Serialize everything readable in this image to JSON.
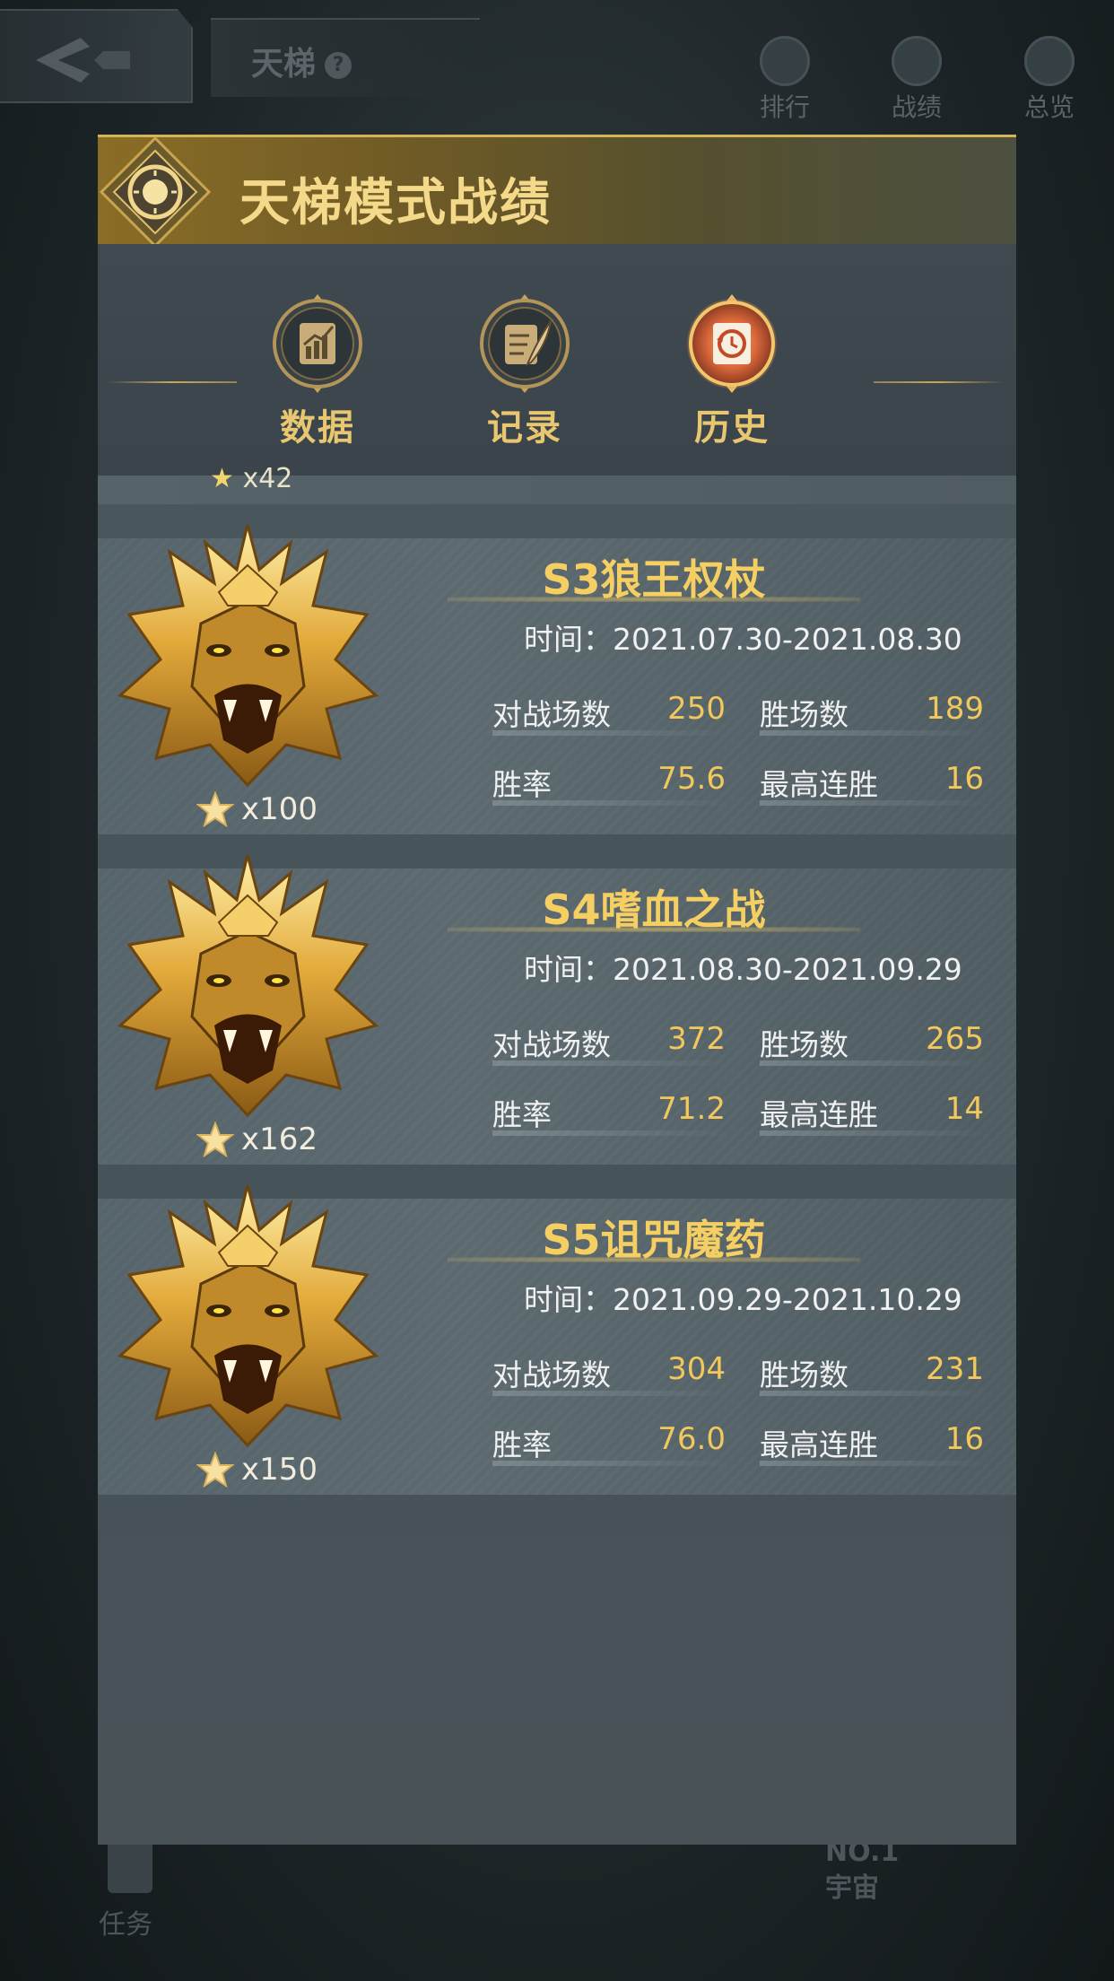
{
  "background": {
    "title": "天梯",
    "help_glyph": "?",
    "top_tabs": [
      "排行",
      "战绩",
      "总览"
    ],
    "bottom_left_label": "任务",
    "bottom_right_line1": "NO.1",
    "bottom_right_line2": "宇宙"
  },
  "panel": {
    "title": "天梯模式战绩",
    "tabs": [
      {
        "label": "数据",
        "icon": "chart-scroll-icon",
        "active": false
      },
      {
        "label": "记录",
        "icon": "quill-scroll-icon",
        "active": false
      },
      {
        "label": "历史",
        "icon": "history-clock-icon",
        "active": true
      }
    ],
    "partial_row_stars": "x42"
  },
  "seasons": [
    {
      "title": "S3狼王权杖",
      "time": "时间：2021.07.30-2021.08.30",
      "stars": "x100",
      "battles_label": "对战场数",
      "battles": "250",
      "wins_label": "胜场数",
      "wins": "189",
      "rate_label": "胜率",
      "rate": "75.6",
      "streak_label": "最高连胜",
      "streak": "16"
    },
    {
      "title": "S4嗜血之战",
      "time": "时间：2021.08.30-2021.09.29",
      "stars": "x162",
      "battles_label": "对战场数",
      "battles": "372",
      "wins_label": "胜场数",
      "wins": "265",
      "rate_label": "胜率",
      "rate": "71.2",
      "streak_label": "最高连胜",
      "streak": "14"
    },
    {
      "title": "S5诅咒魔药",
      "time": "时间：2021.09.29-2021.10.29",
      "stars": "x150",
      "battles_label": "对战场数",
      "battles": "304",
      "wins_label": "胜场数",
      "wins": "231",
      "rate_label": "胜率",
      "rate": "76.0",
      "streak_label": "最高连胜",
      "streak": "16"
    }
  ],
  "colors": {
    "gold": "#f6cf63",
    "tab_label": "#e9c770",
    "panel_bg": "#4c585d"
  }
}
